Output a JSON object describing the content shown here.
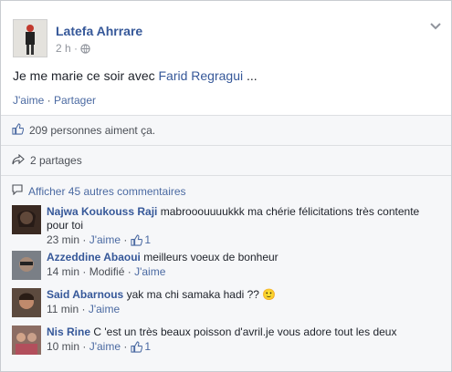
{
  "post": {
    "author": "Latefa Ahrrare",
    "time": "2 h",
    "separator": "·",
    "text_prefix": "Je me marie ce soir avec ",
    "text_link": "Farid Regragui",
    "text_suffix": " ...",
    "like_label": "J'aime",
    "share_label": "Partager"
  },
  "summary": {
    "likes_text": "209 personnes aiment ça.",
    "shares_text": "2 partages",
    "more_comments": "Afficher 45 autres commentaires"
  },
  "comments": [
    {
      "name": "Najwa Koukouss Raji",
      "text": "mabrooouuuukkk ma chérie félicitations très contente pour toi",
      "time": "23 min",
      "like_label": "J'aime",
      "like_count": "1"
    },
    {
      "name": "Azzeddine Abaoui",
      "text": "meilleurs voeux de bonheur",
      "time": "14 min",
      "modified": "Modifié",
      "like_label": "J'aime"
    },
    {
      "name": "Said Abarnous",
      "text": "yak ma chi samaka hadi ?? ",
      "emoji": "🙂",
      "time": "11 min",
      "like_label": "J'aime"
    },
    {
      "name": "Nis Rine",
      "text": "C 'est un très beaux poisson d'avril.je vous adore tout les deux",
      "time": "10 min",
      "like_label": "J'aime",
      "like_count": "1"
    }
  ],
  "colors": {
    "link_blue": "#365899",
    "action_blue": "#4b6aa2",
    "meta_gray": "#90949c"
  }
}
